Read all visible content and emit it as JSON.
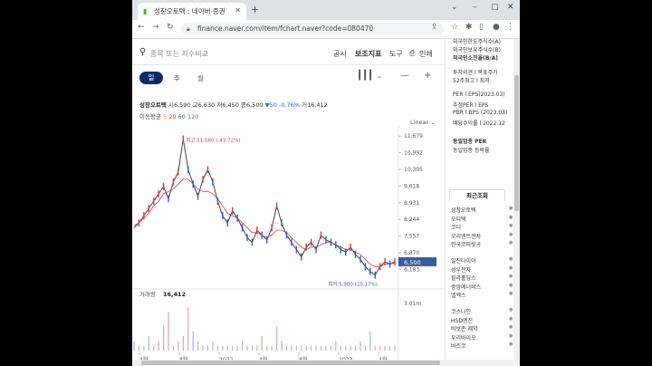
{
  "browser": {
    "tab_title": "성창오토텍 : 네이버 증권",
    "url": "finance.naver.com/item/fchart.naver?code=080470"
  },
  "search": {
    "placeholder": "종목 또는 지수비교",
    "menu": [
      "공시",
      "보조지표",
      "도구",
      "인쇄"
    ]
  },
  "periods": {
    "active": "일",
    "others": [
      "주",
      "월"
    ]
  },
  "stock": {
    "name": "성창오토텍",
    "open_label": "시",
    "open": "6,590",
    "high_label": "고",
    "high": "6,630",
    "low_label": "저",
    "low": "6,450",
    "close_label": "종",
    "close": "6,500",
    "change": "▼50 -0.76%",
    "volume_label": "거",
    "volume": "16,412",
    "ma_label": "이동평균",
    "ma": [
      "5",
      "20",
      "60",
      "120"
    ],
    "scale": "Linear"
  },
  "chart_data": {
    "type": "line",
    "title": "",
    "ylabel": "",
    "x_ticks": [
      "4월",
      "8월",
      "2022",
      "4월",
      "8월",
      "2023",
      "4월"
    ],
    "y_ticks": [
      11679,
      10992,
      10305,
      9618,
      8931,
      8244,
      7557,
      6870,
      6183
    ],
    "ylim": [
      5900,
      11800
    ],
    "current_price": "6,500",
    "max_label": "최고 11,560 (-43.72%)",
    "min_label": "최저 5,900 (10.17%)",
    "series": [
      {
        "values": [
          7900,
          8100,
          8400,
          8700,
          9000,
          9300,
          9600,
          9100,
          9800,
          10200,
          11560,
          10300,
          9700,
          9200,
          9900,
          10300,
          9800,
          9000,
          8400,
          8100,
          8600,
          8300,
          7900,
          7500,
          7300,
          7800,
          7600,
          7400,
          7900,
          8800,
          8100,
          7600,
          7300,
          7000,
          6700,
          7100,
          7300,
          7000,
          7600,
          7400,
          7300,
          7200,
          7000,
          6900,
          7100,
          6800,
          6600,
          6300,
          6100,
          5950,
          6300,
          6500,
          6400,
          6500
        ]
      },
      {
        "values": [
          8000,
          8100,
          8300,
          8500,
          8800,
          9000,
          9300,
          9400,
          9500,
          9700,
          9900,
          9900,
          9700,
          9500,
          9400,
          9400,
          9300,
          9100,
          8800,
          8500,
          8400,
          8300,
          8100,
          7900,
          7700,
          7700,
          7600,
          7500,
          7600,
          7800,
          7800,
          7700,
          7500,
          7300,
          7100,
          7000,
          7100,
          7100,
          7200,
          7300,
          7300,
          7200,
          7100,
          7000,
          7000,
          6900,
          6800,
          6600,
          6400,
          6300,
          6300,
          6400,
          6400,
          6450
        ]
      }
    ],
    "volume_label": "거래량",
    "volume_value": "16,412",
    "volume_axis": "3.01m",
    "volume": [
      2,
      1,
      1,
      3,
      1,
      2,
      5,
      8,
      1,
      2,
      3,
      9,
      4,
      2,
      1,
      1,
      2,
      1,
      1,
      1,
      1,
      1,
      2,
      1,
      1,
      1,
      3,
      1,
      1,
      5,
      2,
      1,
      1,
      1,
      1,
      1,
      1,
      1,
      1,
      1,
      1,
      2,
      1,
      1,
      1,
      1,
      2,
      1,
      4,
      1,
      1,
      1,
      1,
      1
    ]
  },
  "right_panel": {
    "top_items": [
      "외국인한도주식수(A)",
      "외국인보유주식수(B)",
      "외국인소진율(B/A)"
    ],
    "opinion": [
      "투자의견  l  목표주가",
      "52주최고  l  최저"
    ],
    "per": [
      "PER l EPS(2023.03)",
      "추정PER l EPS",
      "PBR l BPS (2023.03)",
      "배당수익률 l 2022.12"
    ],
    "sector": [
      "동일업종 PER",
      "동일업종 등락률"
    ],
    "recent_title": "최근조회",
    "recent": [
      "성창오토텍",
      "오디텍",
      "코디",
      "오리엔트전자",
      "한국코퍼릿공",
      "일진다이아",
      "성우전자",
      "힐라홀딩스",
      "중앙에너비스",
      "엘엑스",
      "코스나인",
      "HSD엔진",
      "비보존 제약",
      "우리바이오",
      "바즈코"
    ]
  },
  "colors": {
    "navy": "#0c2a6b",
    "up": "#e5343b",
    "down": "#2b5ce6",
    "price_tag": "#3d5b9a"
  }
}
